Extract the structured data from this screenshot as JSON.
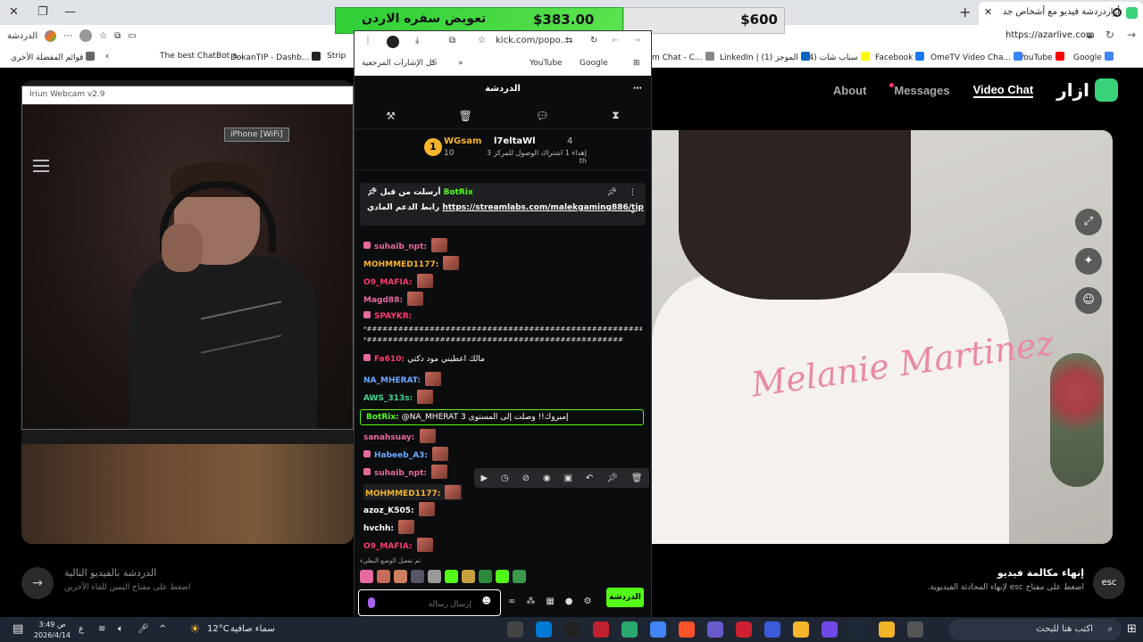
{
  "browser": {
    "tab_title": "أزاردردشة فيديو مع أشخاص جد",
    "tab_close": "✕",
    "new_tab": "+",
    "url": "https://azarlive.com",
    "profile_label": "الدردشة",
    "bookmarks": [
      {
        "label": "Google",
        "color": "#4285f4"
      },
      {
        "label": "YouTube",
        "color": "#ff0000"
      },
      {
        "label": "OmeTV Video Cha...",
        "color": "#3b82f6"
      },
      {
        "label": "Facebook",
        "color": "#1877f2"
      },
      {
        "label": "(4) سناب شات",
        "color": "#fffc00"
      },
      {
        "label": "LinkedIn | (1) الموجز",
        "color": "#0a66c2"
      },
      {
        "label": "m Chat - C...",
        "color": "#888888"
      },
      {
        "label": "Strip",
        "color": "#666666"
      },
      {
        "label": "DokanTIP - Dashb...",
        "color": "#222222"
      },
      {
        "label": "The best ChatBot a...",
        "color": "#cccccc"
      },
      {
        "label": "قوائم المفضلة الأخرى",
        "color": "#666666"
      }
    ]
  },
  "donation": {
    "label": "تعويض سفره الاردن",
    "amount_current": "$383.00",
    "amount_goal": "$600",
    "progress": 0.64
  },
  "azar": {
    "nav": {
      "about": "About",
      "messages": "Messages",
      "video_chat": "Video Chat",
      "logo_text": "ازار"
    },
    "webcam_title": "Iriun Webcam v2.9",
    "iphone_label": "iPhone [WiFi]",
    "shirt_text": "Melanie Martinez",
    "next_chat": {
      "title": "الدردشة بالفيديو التالية",
      "hint": "اضغط على مفتاح اليمين للقاء الآخرين",
      "arrow": "→"
    },
    "end_chat": {
      "key": "esc",
      "title": "إنهاء مكالمة فيديو",
      "hint": "اضغط على مفتاح esc لإنهاء المحادثة الفيديوية."
    }
  },
  "kick": {
    "address": "kick.com/popo...",
    "bookmarks": {
      "google": "Google",
      "youtube": "YouTube",
      "all": "كل الإشارات المرجعية"
    },
    "header": "الدردشة",
    "leaderboard": {
      "rank": "1",
      "top_name": "WGsam",
      "top_points": "10",
      "second_name": "l7eltaWl",
      "second_points": "4",
      "sub_text": "إهداء 1 اشتراك الوصول للمركز 3 th"
    },
    "pinned": {
      "by": "أرسلت من قبل",
      "bot": "BotRix",
      "prefix": "رابط الدعم المادي",
      "link": "https://streamlabs.com/malekgaming886/tip"
    },
    "messages": [
      {
        "user": "suhaib_npt:",
        "color": "#e66aa0"
      },
      {
        "user": "MOHMMED1177:",
        "color": "#f7b52c"
      },
      {
        "user": "O9_MAFIA:",
        "color": "#ff3b6b"
      },
      {
        "user": "Magd88:",
        "color": "#e66aa0"
      },
      {
        "user": "SPAYKR:",
        "color": "#ff3b6b"
      },
      {
        "user": "Fa610:",
        "color": "#ff3b6b"
      },
      {
        "user": "NA_MHERAT:",
        "color": "#6aa8ff"
      },
      {
        "user": "AWS_313s:",
        "color": "#3dd68c"
      },
      {
        "user": "sanahsuay:",
        "color": "#e66aa0"
      },
      {
        "user": "Habeeb_A3:",
        "color": "#6aa8ff"
      },
      {
        "user": "suhaib_npt:",
        "color": "#e66aa0"
      },
      {
        "user": "MOHMMED1177:",
        "color": "#f7b52c"
      },
      {
        "user": "azoz_K505:",
        "color": "#ffffff"
      },
      {
        "user": "hvchh:",
        "color": "#ffffff"
      },
      {
        "user": "O9_MAFIA:",
        "color": "#ff3b6b"
      }
    ],
    "spam_line1": "*###############################################################",
    "spam_line2": "*#################################################",
    "fa610_text": "مالك اعطيني مود دكتي",
    "bot_message": {
      "bot": "BotRix:",
      "text": "@NA_MHERAT 3 إمبروك!! وصلت إلى المستوى"
    },
    "footer_note": "تم تفعيل الوضع البطيء",
    "input_placeholder": "إرسال رسالة",
    "send_label": "الدردشة"
  },
  "taskbar": {
    "time": "3:49 ص",
    "date": "2026/4/14",
    "lang": "ع",
    "weather": "سماء صافية",
    "temp": "12°C",
    "search_placeholder": "اكتب هنا للبحث"
  }
}
